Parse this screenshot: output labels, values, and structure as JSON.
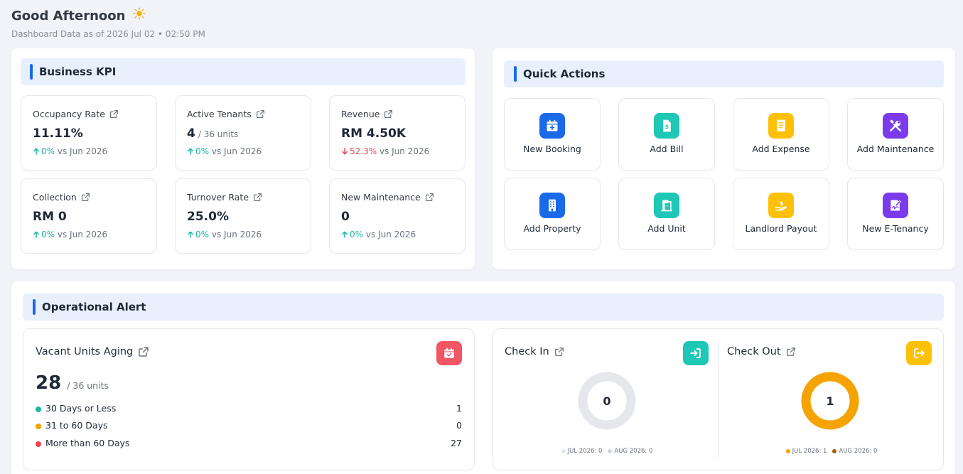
{
  "header": {
    "greeting": "Good Afternoon",
    "subtitle": "Dashboard Data as of 2026 Jul 02 • 02:50 PM"
  },
  "kpi": {
    "title": "Business KPI",
    "cards": [
      {
        "label": "Occupancy Rate",
        "value": "11.11%",
        "unit": "",
        "change": "0%",
        "direction": "up",
        "compare": "vs Jun 2026"
      },
      {
        "label": "Active Tenants",
        "value": "4",
        "unit": "/ 36 units",
        "change": "0%",
        "direction": "up",
        "compare": "vs Jun 2026"
      },
      {
        "label": "Revenue",
        "value": "RM 4.50K",
        "unit": "",
        "change": "52.3%",
        "direction": "down",
        "compare": "vs Jun 2026"
      },
      {
        "label": "Collection",
        "value": "RM 0",
        "unit": "",
        "change": "0%",
        "direction": "up",
        "compare": "vs Jun 2026"
      },
      {
        "label": "Turnover Rate",
        "value": "25.0%",
        "unit": "",
        "change": "0%",
        "direction": "up",
        "compare": "vs Jun 2026"
      },
      {
        "label": "New Maintenance",
        "value": "0",
        "unit": "",
        "change": "0%",
        "direction": "up",
        "compare": "vs Jun 2026"
      }
    ]
  },
  "quick_actions": {
    "title": "Quick Actions",
    "items": [
      {
        "label": "New Booking",
        "icon": "calendar-plus-icon",
        "color": "#1a6ae8"
      },
      {
        "label": "Add Bill",
        "icon": "bill-icon",
        "color": "#1ec7b6"
      },
      {
        "label": "Add Expense",
        "icon": "receipt-icon",
        "color": "#ffc107"
      },
      {
        "label": "Add Maintenance",
        "icon": "tools-icon",
        "color": "#7c3aed"
      },
      {
        "label": "Add Property",
        "icon": "building-icon",
        "color": "#1a6ae8"
      },
      {
        "label": "Add Unit",
        "icon": "door-icon",
        "color": "#1ec7b6"
      },
      {
        "label": "Landlord Payout",
        "icon": "payout-icon",
        "color": "#ffc107"
      },
      {
        "label": "New E-Tenancy",
        "icon": "sign-document-icon",
        "color": "#7c3aed"
      }
    ]
  },
  "alerts": {
    "title": "Operational Alert",
    "vacant": {
      "title": "Vacant Units Aging",
      "count": "28",
      "unit": "/ 36 units",
      "rows": [
        {
          "label": "30 Days or Less",
          "value": "1",
          "color": "#1ab8a4"
        },
        {
          "label": "31 to 60 Days",
          "value": "0",
          "color": "#f5a300"
        },
        {
          "label": "More than 60 Days",
          "value": "27",
          "color": "#e8474c"
        }
      ]
    },
    "check_in": {
      "title": "Check In",
      "total": "0",
      "legend": [
        {
          "label": "JUL 2026: 0",
          "color": "#e5e7eb",
          "value": 0
        },
        {
          "label": "AUG 2026: 0",
          "color": "#d1d5db",
          "value": 0
        }
      ]
    },
    "check_out": {
      "title": "Check Out",
      "total": "1",
      "legend": [
        {
          "label": "JUL 2026: 1",
          "color": "#f5a300",
          "value": 1
        },
        {
          "label": "AUG 2026: 0",
          "color": "#a0620a",
          "value": 0
        }
      ]
    }
  },
  "colors": {
    "accent": "#1a6ae8",
    "up": "#1ab8a4",
    "down": "#e8474c"
  }
}
